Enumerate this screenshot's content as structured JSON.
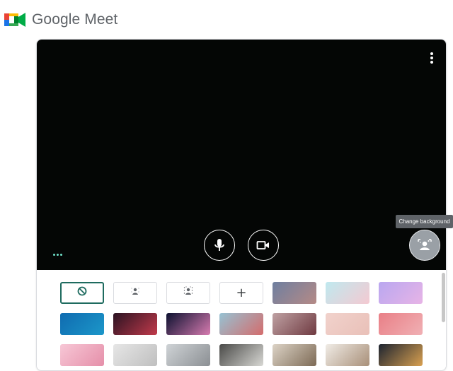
{
  "app": {
    "title": "Google Meet",
    "accent": "#1e6b5f"
  },
  "preview": {
    "background": "#040605",
    "more_icon": "more-vert-icon",
    "controls": [
      {
        "name": "microphone",
        "icon": "mic-icon"
      },
      {
        "name": "camera",
        "icon": "videocam-icon"
      }
    ],
    "change_background_icon": "change-background-icon",
    "tooltip": "Change background"
  },
  "background_options": {
    "effects": [
      {
        "id": "none",
        "icon": "block-icon",
        "selected": true
      },
      {
        "id": "slight-blur",
        "icon": "blur-slight-icon",
        "selected": false
      },
      {
        "id": "blur",
        "icon": "blur-icon",
        "selected": false
      },
      {
        "id": "upload",
        "label": "+",
        "icon": "add-icon",
        "selected": false
      }
    ],
    "images": [
      {
        "id": "bg-sunset-horizon",
        "colors": [
          "#6e7fa0",
          "#b58a86"
        ]
      },
      {
        "id": "bg-beach",
        "colors": [
          "#bfe9ef",
          "#f4c9d1"
        ]
      },
      {
        "id": "bg-purple-clouds",
        "colors": [
          "#b9a7f0",
          "#e7b4e6"
        ]
      },
      {
        "id": "bg-blue-water",
        "colors": [
          "#0f6bb0",
          "#1c97c9"
        ]
      },
      {
        "id": "bg-nebula",
        "colors": [
          "#2b1322",
          "#c13a4b"
        ]
      },
      {
        "id": "bg-fireworks",
        "colors": [
          "#0c1130",
          "#d77bb0"
        ]
      },
      {
        "id": "bg-blossom-sky",
        "colors": [
          "#96c2d3",
          "#d46c6c"
        ]
      },
      {
        "id": "bg-pink-petals",
        "colors": [
          "#bfa1a3",
          "#6f3a41"
        ]
      },
      {
        "id": "bg-pink-dots",
        "colors": [
          "#f1d2cc",
          "#e9c0b8"
        ]
      },
      {
        "id": "bg-pink-grid",
        "colors": [
          "#e97f86",
          "#f0b0b4"
        ]
      },
      {
        "id": "bg-pink-flowers",
        "colors": [
          "#f7c7d6",
          "#e58fa9"
        ]
      },
      {
        "id": "bg-office-light",
        "colors": [
          "#e6e6e6",
          "#bfbfbf"
        ]
      },
      {
        "id": "bg-office-window",
        "colors": [
          "#cfd3d6",
          "#8b8f93"
        ]
      },
      {
        "id": "bg-room-dark",
        "colors": [
          "#4a4a48",
          "#d8d8d4"
        ]
      },
      {
        "id": "bg-bookshelf",
        "colors": [
          "#dcd3c6",
          "#7d6a55"
        ]
      },
      {
        "id": "bg-living-room",
        "colors": [
          "#f0ece6",
          "#a88f78"
        ]
      },
      {
        "id": "bg-night-building",
        "colors": [
          "#1d2430",
          "#d9a050"
        ]
      }
    ]
  }
}
